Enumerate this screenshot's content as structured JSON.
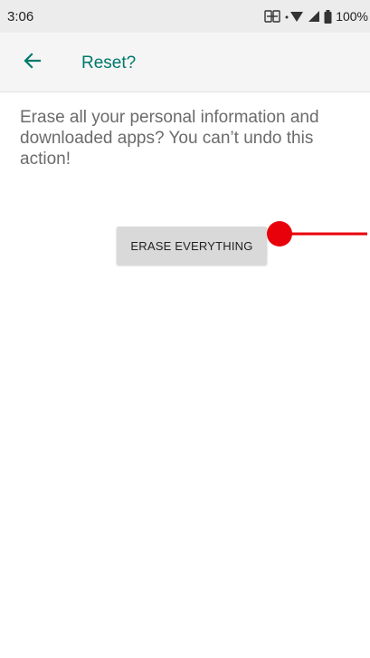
{
  "status_bar": {
    "time": "3:06",
    "battery": "100%"
  },
  "app_bar": {
    "title": "Reset?"
  },
  "content": {
    "message": "Erase all your personal information and downloaded apps? You can’t undo this action!",
    "erase_button_label": "ERASE EVERYTHING"
  },
  "colors": {
    "accent": "#00796b",
    "touch_marker": "#e8000b"
  },
  "icons": {
    "back": "arrow-left-icon",
    "status": [
      "nfc-icon",
      "wifi-icon",
      "signal-icon",
      "battery-icon"
    ]
  }
}
